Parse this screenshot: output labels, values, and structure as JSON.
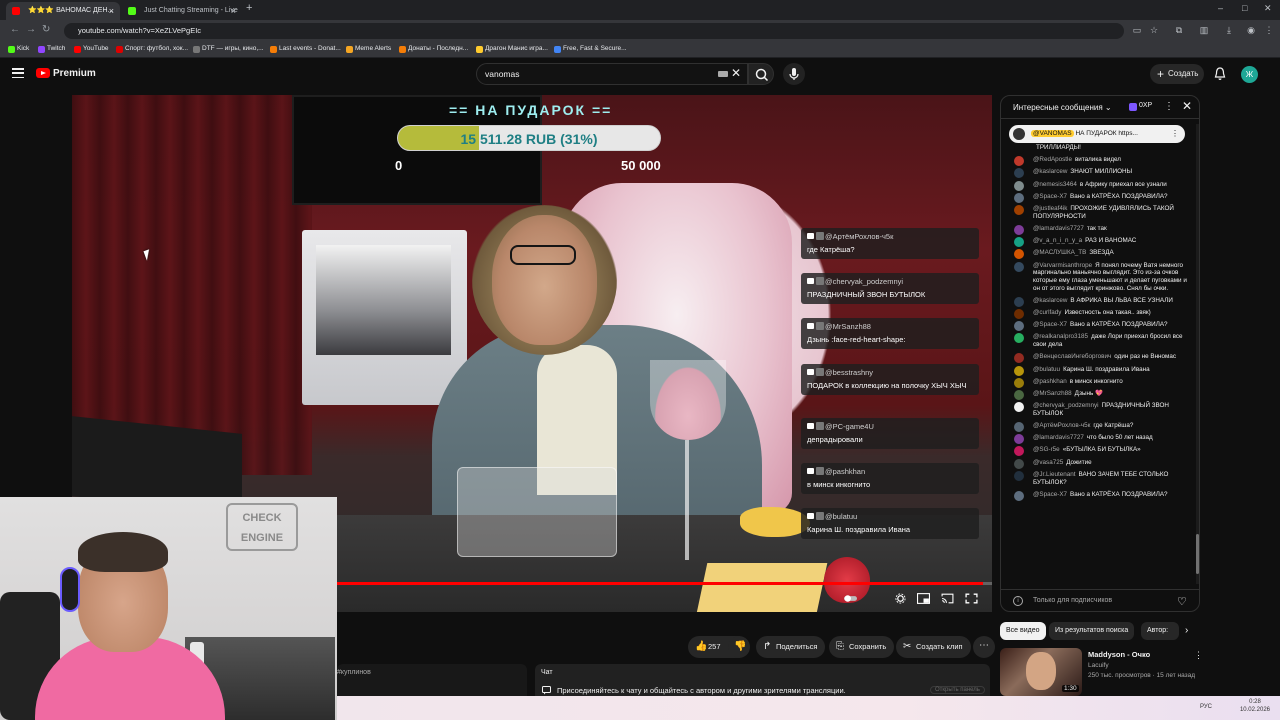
{
  "browser": {
    "tabs": [
      {
        "label": "⭐⭐⭐ ВАНОМАС ДЕН...",
        "active": true,
        "favicon_color": "#ff0000"
      },
      {
        "label": "Just Chatting Streaming - Live",
        "active": false,
        "favicon_color": "#53fc18"
      }
    ],
    "new_tab": "+",
    "url": "youtube.com/watch?v=XeZLVePgEIc",
    "bookmarks": [
      {
        "label": "Kick",
        "color": "#53fc18"
      },
      {
        "label": "Twitch",
        "color": "#9146ff"
      },
      {
        "label": "YouTube",
        "color": "#ff0000"
      },
      {
        "label": "Спорт: футбол, хок...",
        "color": "#d00"
      },
      {
        "label": "DTF — игры, кино,...",
        "color": "#333"
      },
      {
        "label": "Last events - Donat...",
        "color": "#f57d07"
      },
      {
        "label": "Meme Alerts",
        "color": "#f5a623"
      },
      {
        "label": "Донаты - Последн...",
        "color": "#f57d07"
      },
      {
        "label": "Драгон Манис игра...",
        "color": "#ffcb2e"
      },
      {
        "label": "Free, Fast & Secure...",
        "color": "#4285f4"
      }
    ]
  },
  "header": {
    "brand": "Premium",
    "search_value": "vanomas",
    "create_label": "Создать",
    "avatar_letter": "Ж"
  },
  "stream_overlay": {
    "goal_title": "== НА ПУДАРОК ==",
    "goal_text": "15 511.28 RUB (31%)",
    "goal_fraction": 0.31,
    "goal_min": "0",
    "goal_max": "50 000",
    "chat": [
      {
        "name": "@АртёмРохлов-ч5к",
        "text": "где Катрёша?"
      },
      {
        "name": "@chervyak_podzemnyi",
        "text": "ПРАЗДНИЧНЫЙ ЗВОН БУТЫЛОК"
      },
      {
        "name": "@MrSanzh88",
        "text": "Дзынь :face-red-heart-shape:"
      },
      {
        "name": "@besstrashny",
        "text": "ПОДАРОК в коллекцию на полочку ХЫЧ ХЫЧ"
      },
      {
        "name": "@PC-game4U",
        "text": "депрадыровали"
      },
      {
        "name": "@pashkhan",
        "text": "в минск инкогнито"
      },
      {
        "name": "@bulatuu",
        "text": "Карина Ш. поздравила Ивана"
      }
    ]
  },
  "webcam": {
    "sign_line1": "CHECK",
    "sign_line2": "ENGINE"
  },
  "player": {
    "progress_fraction": 0.99
  },
  "actions": {
    "likes": "257",
    "share": "Поделиться",
    "save": "Сохранить",
    "clip": "Создать клип"
  },
  "under": {
    "left_text": "#куплинов",
    "chat_title": "Чат",
    "chat_info": "Присоединяйтесь к чату и общайтесь с автором и другими зрителями трансляции.",
    "chat_button": "Открыть панель"
  },
  "chat": {
    "title": "Интересные сообщения",
    "xp": "0XP",
    "pinned_name": "@VANOMAS",
    "pinned_text": "НА ПУДАРОК https...",
    "messages": [
      {
        "name": "",
        "text": "ТРИЛЛИАРДЫ!",
        "color": "#0f0f0f"
      },
      {
        "name": "@RedApostle",
        "text": "виталика видел",
        "color": "#c0392b"
      },
      {
        "name": "@kaslarcew",
        "text": "ЗНАЮТ МИЛЛИОНЫ",
        "color": "#2c3e50"
      },
      {
        "name": "@nemesis3464",
        "text": "в Африку приехал все узнали",
        "color": "#7f8c8d"
      },
      {
        "name": "@Space-X7",
        "text": "Вано а КАТРЁХА ПОЗДРАВИЛА?",
        "color": "#5d6d7e"
      },
      {
        "name": "@justleaf4ik",
        "text": "ПРОХОЖИЕ УДИВЛЯЛИСЬ ТАКОЙ ПОПУЛЯРНОСТИ",
        "color": "#a04000"
      },
      {
        "name": "@lamardavis7727",
        "text": "так так",
        "color": "#7d3c98"
      },
      {
        "name": "@v_a_n_i_n_y_a",
        "text": "РАЗ И ВАНОМАС",
        "color": "#16a085"
      },
      {
        "name": "@МАСЛУШКА_ТВ",
        "text": "ЗВЕЗДА",
        "color": "#d35400"
      },
      {
        "name": "@Varvarmisanthrope",
        "text": "Я понял почему Ватя немного маргинально маньячно выглядит. Это из-за очков которые ему глаза уменьшают и делает пуговками и он от этого выглядит кринжово. Снял бы очки.",
        "color": "#34495e"
      },
      {
        "name": "@kaslarcew",
        "text": "В АФРИКА ВЫ ЛЬВА ВСЕ УЗНАЛИ",
        "color": "#2c3e50"
      },
      {
        "name": "@curlfady",
        "text": "Известность она такая.. звяк)",
        "color": "#6e2c00"
      },
      {
        "name": "@Space-X7",
        "text": "Вано а КАТРЁХА ПОЗДРАВИЛА?",
        "color": "#5d6d7e"
      },
      {
        "name": "@realkanalpro3185",
        "text": "даже Лори приехал бросил все свои дела",
        "color": "#27ae60"
      },
      {
        "name": "@ВенцеславИнгеборгович",
        "text": "один раз не Внномас",
        "color": "#922b21"
      },
      {
        "name": "@bulatuu",
        "text": "Карина Ш. поздравила Ивана",
        "color": "#b7950b"
      },
      {
        "name": "@pashkhan",
        "text": "в минск инкогнито",
        "color": "#9a7d0a"
      },
      {
        "name": "@MrSanzh88",
        "text": "Дзынь 💖",
        "color": "#4a6741"
      },
      {
        "name": "@chervyak_podzemnyi",
        "text": "ПРАЗДНИЧНЫЙ ЗВОН БУТЫЛОК",
        "color": "#f1f1f1"
      },
      {
        "name": "@АртёмРохлов-ч5к",
        "text": "где Катрёша?",
        "color": "#566573"
      },
      {
        "name": "@lamardavis7727",
        "text": "что было 50 лет назад",
        "color": "#7d3c98"
      },
      {
        "name": "@SG-r5e",
        "text": "«БУТЫЛКА БИ БУТЫЛКА»",
        "color": "#c2185b"
      },
      {
        "name": "@vasa725",
        "text": "Дожитие",
        "color": "#424949"
      },
      {
        "name": "@Jr.Lieutenant",
        "text": "ВАНО ЗАЧЕМ ТЕБЕ СТОЛЬКО БУТЫЛОК?",
        "color": "#212f3d"
      },
      {
        "name": "@Space-X7",
        "text": "Вано а КАТРЁХА ПОЗДРАВИЛА?",
        "color": "#5d6d7e"
      }
    ],
    "footer": "Только для подписчиков"
  },
  "recs": {
    "tabs": [
      "Все видео",
      "Из результатов поиска",
      "Автор: "
    ],
    "title": "Maddyson - Очко",
    "channel": "Lacuify",
    "meta": "250 тыс. просмотров · 15 лет назад",
    "duration": "1:30"
  },
  "tray": {
    "lang": "РУС",
    "time": "0:28",
    "date": "10.02.2026"
  }
}
